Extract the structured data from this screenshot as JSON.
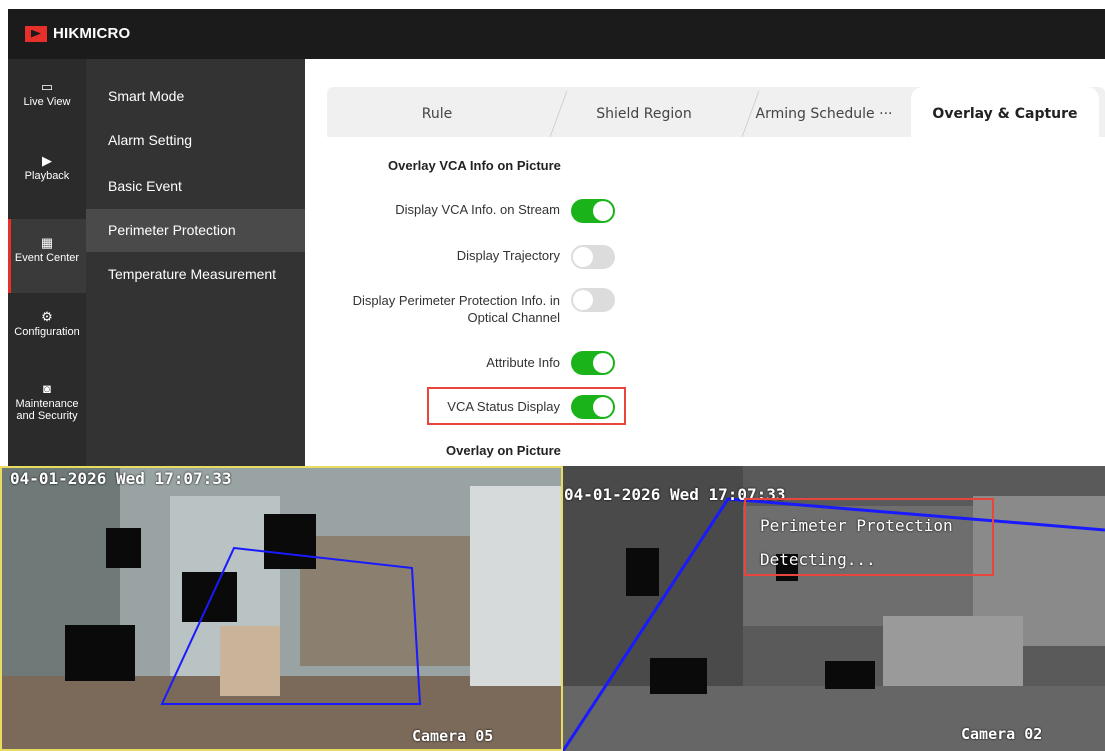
{
  "brand": {
    "name": "HIKMICRO",
    "accent": "#e8302a"
  },
  "left_nav": [
    {
      "label": "Live View",
      "icon": "monitor-icon"
    },
    {
      "label": "Playback",
      "icon": "play-icon"
    },
    {
      "label": "Event Center",
      "icon": "grid-icon"
    },
    {
      "label": "Configuration",
      "icon": "gear-icon"
    },
    {
      "label": "Maintenance and Security",
      "label_line1": "Maintenance",
      "label_line2": "and Security",
      "icon": "shield-search-icon"
    }
  ],
  "sub_nav": [
    {
      "label": "Smart Mode"
    },
    {
      "label": "Alarm Setting"
    },
    {
      "label": "Basic Event"
    },
    {
      "label": "Perimeter Protection"
    },
    {
      "label": "Temperature Measurement"
    }
  ],
  "tabs": [
    {
      "label": "Rule"
    },
    {
      "label": "Shield Region"
    },
    {
      "label": "Arming Schedule ···"
    },
    {
      "label": "Overlay & Capture"
    }
  ],
  "settings": {
    "section1_title": "Overlay VCA Info on Picture",
    "rows": [
      {
        "label": "Display VCA Info. on Stream",
        "state": "on"
      },
      {
        "label": "Display Trajectory",
        "state": "off"
      },
      {
        "label_line1": "Display Perimeter Protection Info. in",
        "label_line2": "Optical Channel",
        "state": "off"
      },
      {
        "label": "Attribute Info",
        "state": "on"
      },
      {
        "label": "VCA Status Display",
        "state": "on"
      }
    ],
    "section2_title": "Overlay on Picture"
  },
  "cameras": {
    "left": {
      "timestamp": "04-01-2026 Wed 17:07:33",
      "name": "Camera 05"
    },
    "right": {
      "timestamp": "04-01-2026 Wed 17:07:33",
      "name": "Camera 02",
      "status_line1": "Perimeter Protection",
      "status_line2": "Detecting..."
    }
  },
  "colors": {
    "toggle_on": "#1ab31a",
    "toggle_off": "#dcdcdc",
    "highlight": "#e8453c",
    "region_line": "#1a1aff"
  }
}
